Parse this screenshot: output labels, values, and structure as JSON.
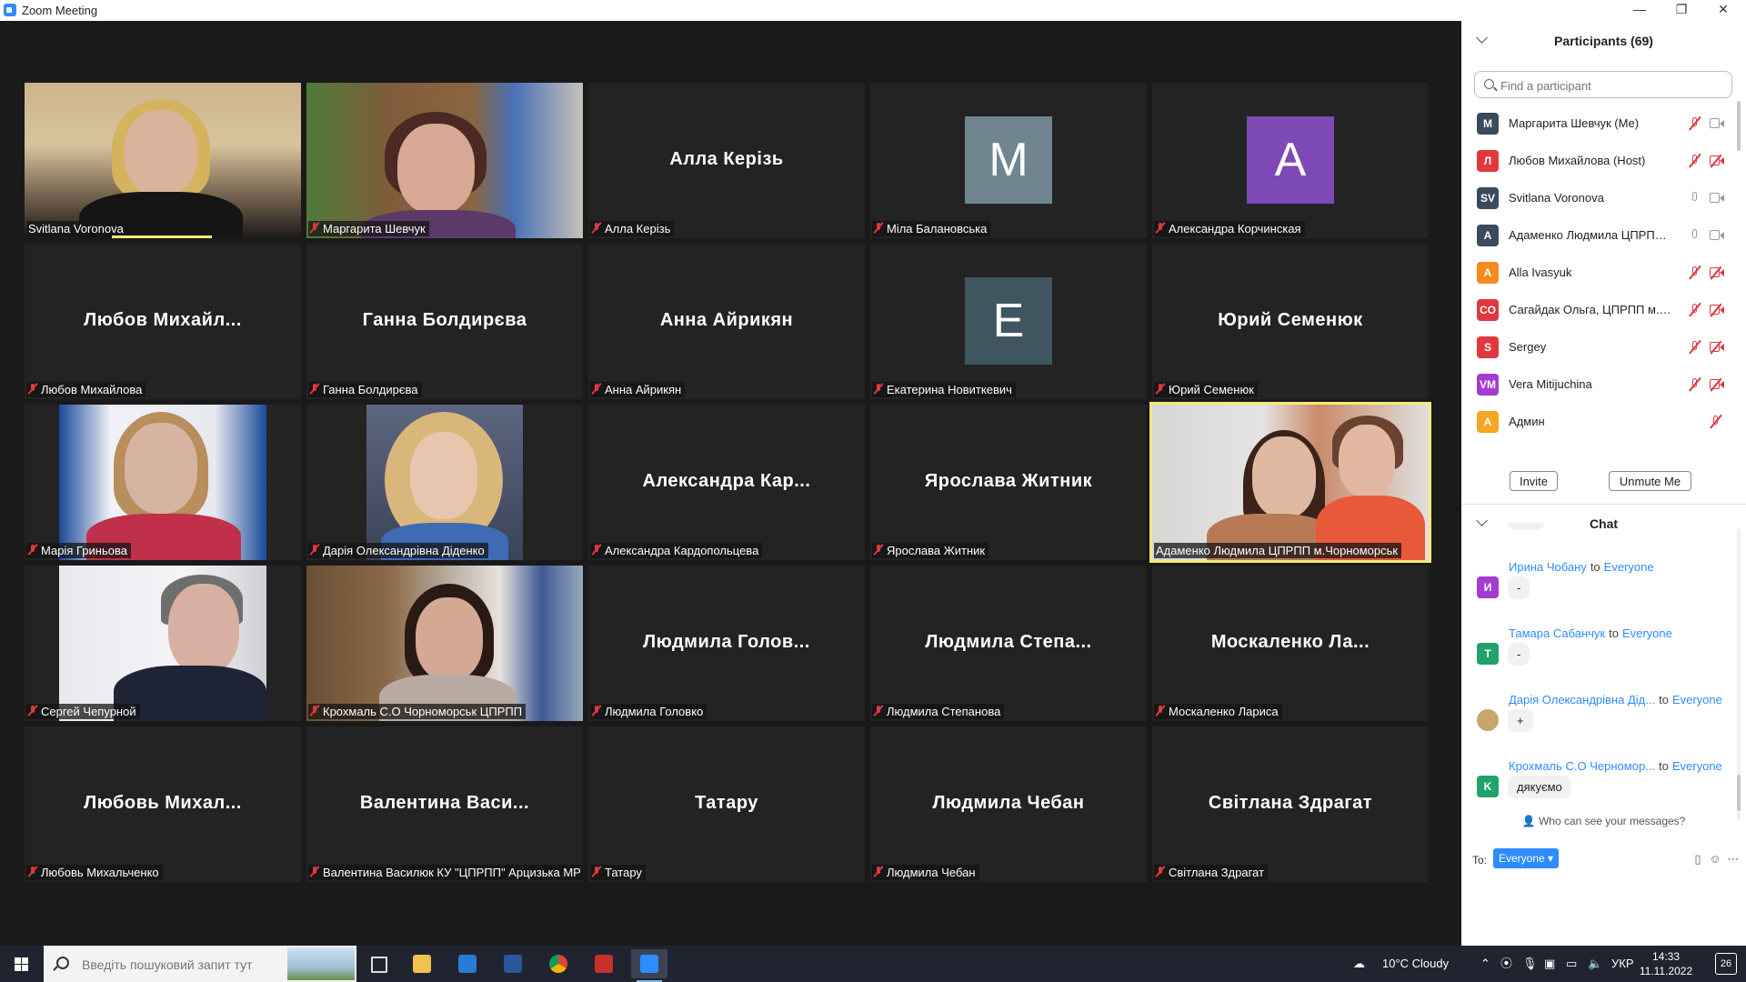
{
  "window": {
    "title": "Zoom Meeting",
    "min_glyph": "—",
    "max_glyph": "❐",
    "close_glyph": "✕"
  },
  "tiles": [
    {
      "name": "Svitlana Voronova",
      "mode": "video",
      "photo": "ph1",
      "muted": false,
      "speaking": true
    },
    {
      "name": "Маргарита Шевчук",
      "mode": "video",
      "photo": "ph2",
      "muted": true
    },
    {
      "name": "Алла Керізь",
      "mode": "text",
      "display": "Алла Керізь",
      "muted": true
    },
    {
      "name": "Міла Балановська",
      "mode": "avatar",
      "letter": "M",
      "color": "#6f8590",
      "muted": true
    },
    {
      "name": "Александра Корчинская",
      "mode": "avatar",
      "letter": "A",
      "color": "#7d4ab5",
      "muted": true
    },
    {
      "name": "Любов Михайлова",
      "mode": "text",
      "display": "Любов  Михайл...",
      "muted": true
    },
    {
      "name": "Ганна Болдирєва",
      "mode": "text",
      "display": "Ганна Болдирєва",
      "muted": true
    },
    {
      "name": "Анна Айрикян",
      "mode": "text",
      "display": "Анна Айрикян",
      "muted": true
    },
    {
      "name": "Екатерина Новиткевич",
      "mode": "avatar",
      "letter": "E",
      "color": "#3f5560",
      "muted": true
    },
    {
      "name": "Юрий Семенюк",
      "mode": "text",
      "display": "Юрий Семенюк",
      "muted": true
    },
    {
      "name": "Марія Гриньова",
      "mode": "video",
      "photo": "ph3",
      "muted": true
    },
    {
      "name": "Дарія Олександрівна Діденко",
      "mode": "video",
      "photo": "ph4",
      "muted": true
    },
    {
      "name": "Александра Кардопольцева",
      "mode": "text",
      "display": "Александра  Кар...",
      "muted": true
    },
    {
      "name": "Ярослава Житник",
      "mode": "text",
      "display": "Ярослава Житник",
      "muted": true
    },
    {
      "name": "Адаменко Людмила ЦПРПП м.Чорноморськ",
      "mode": "video",
      "photo": "ph5",
      "muted": false,
      "active": true
    },
    {
      "name": "Сергей Чепурной",
      "mode": "video",
      "photo": "ph6",
      "muted": true
    },
    {
      "name": "Крохмаль С.О Чорноморськ ЦПРПП",
      "mode": "video",
      "photo": "ph7",
      "muted": true
    },
    {
      "name": "Людмила Головко",
      "mode": "text",
      "display": "Людмила  Голов...",
      "muted": true
    },
    {
      "name": "Людмила Степанова",
      "mode": "text",
      "display": "Людмила  Степа...",
      "muted": true
    },
    {
      "name": "Москаленко Лариса",
      "mode": "text",
      "display": "Москаленко  Ла...",
      "muted": true
    },
    {
      "name": "Любовь Михальченко",
      "mode": "text",
      "display": "Любовь  Михал...",
      "muted": true
    },
    {
      "name": "Валентина Василюк КУ \"ЦПРПП\" Арцизька МР",
      "mode": "text",
      "display": "Валентина  Васи...",
      "muted": true
    },
    {
      "name": "Татару",
      "mode": "text",
      "display": "Татару",
      "muted": true
    },
    {
      "name": "Людмила Чебан",
      "mode": "text",
      "display": "Людмила Чебан",
      "muted": true
    },
    {
      "name": "Світлана Здрагат",
      "mode": "text",
      "display": "Світлана Здрагат",
      "muted": true
    }
  ],
  "participants": {
    "title": "Participants (69)",
    "search_placeholder": "Find a participant",
    "items": [
      {
        "initials": "M",
        "color": "#3b4a5c",
        "name": "Маргарита Шевчук (Me)",
        "mic": "muted",
        "cam": "on"
      },
      {
        "initials": "Л",
        "color": "#e0383e",
        "name": "Любов Михайлова (Host)",
        "mic": "muted",
        "cam": "off"
      },
      {
        "initials": "SV",
        "color": "#3b4a5c",
        "name": "Svitlana Voronova",
        "mic": "on",
        "cam": "on"
      },
      {
        "initials": "A",
        "color": "#3b4a5c",
        "name": "Адаменко Людмила ЦПРПП м...",
        "mic": "on",
        "cam": "on"
      },
      {
        "initials": "A",
        "color": "#f58b1f",
        "name": "Alla Ivasyuk",
        "mic": "muted",
        "cam": "off"
      },
      {
        "initials": "CO",
        "color": "#e0383e",
        "name": "Сагайдак Ольга, ЦПРПП м.Чо...",
        "mic": "muted",
        "cam": "off"
      },
      {
        "initials": "S",
        "color": "#e0383e",
        "name": "Sergey",
        "mic": "muted",
        "cam": "off"
      },
      {
        "initials": "VM",
        "color": "#a53bd0",
        "name": "Vera Mitijuchina",
        "mic": "muted",
        "cam": "off"
      },
      {
        "initials": "A",
        "color": "#f5a623",
        "name": "Админ",
        "mic": "muted",
        "cam": "none"
      }
    ],
    "invite_label": "Invite",
    "unmute_label": "Unmute Me"
  },
  "chat": {
    "title": "Chat",
    "to_word": "to",
    "messages": [
      {
        "sender": "Ирина Чобану",
        "to": "Everyone",
        "initial": "И",
        "color": "#a53bd0",
        "text": "-"
      },
      {
        "sender": "Тамара Сабанчук",
        "to": "Everyone",
        "initial": "T",
        "color": "#1fa36b",
        "text": "-"
      },
      {
        "sender": "Дарія Олександрівна Дід...",
        "to": "Everyone",
        "initial": "",
        "color": "#c9a56a",
        "text": "+"
      },
      {
        "sender": "Крохмаль С.О Черномор...",
        "to": "Everyone",
        "initial": "K",
        "color": "#1fa36b",
        "text": "дякуємо"
      }
    ],
    "who_can_see": "Who can see your messages?",
    "to_label": "To:",
    "to_value": "Everyone"
  },
  "taskbar": {
    "search_placeholder": "Введіть пошуковий запит тут",
    "weather": "10°C  Cloudy",
    "lang": "УКР",
    "time": "14:33",
    "date": "11.11.2022",
    "notifications": "26"
  },
  "colors": {
    "accent": "#2d8cff",
    "muted_red": "#e0383e",
    "active_speaker": "#f3ea7a"
  }
}
